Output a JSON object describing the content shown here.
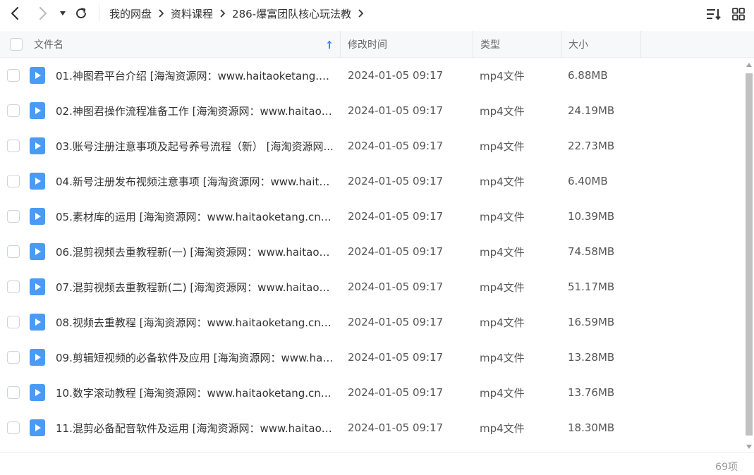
{
  "toolbar": {
    "back_icon": "chevron-left-icon",
    "forward_icon": "chevron-right-icon",
    "history_icon": "caret-down-icon",
    "refresh_icon": "refresh-icon",
    "sort_icon": "sort-icon",
    "view_icon": "grid-view-icon"
  },
  "breadcrumb": [
    "我的网盘",
    "资料课程",
    "286-爆富团队核心玩法教"
  ],
  "table": {
    "columns": {
      "name": "文件名",
      "modified": "修改时间",
      "type": "类型",
      "size": "大小"
    },
    "rows": [
      {
        "name": "01.神图君平台介绍 [海淘资源网：www.haitaoketang.c...",
        "modified": "2024-01-05 09:17",
        "type": "mp4文件",
        "size": "6.88MB"
      },
      {
        "name": "02.神图君操作流程准备工作 [海淘资源网：www.haitaok...",
        "modified": "2024-01-05 09:17",
        "type": "mp4文件",
        "size": "24.19MB"
      },
      {
        "name": "03.账号注册注意事项及起号养号流程（新） [海淘资源网...",
        "modified": "2024-01-05 09:17",
        "type": "mp4文件",
        "size": "22.73MB"
      },
      {
        "name": "04.新号注册发布视频注意事项 [海淘资源网：www.haita...",
        "modified": "2024-01-05 09:17",
        "type": "mp4文件",
        "size": "6.40MB"
      },
      {
        "name": "05.素材库的运用 [海淘资源网：www.haitaoketang.cn]....",
        "modified": "2024-01-05 09:17",
        "type": "mp4文件",
        "size": "10.39MB"
      },
      {
        "name": "06.混剪视频去重教程新(一) [海淘资源网：www.haitaok...",
        "modified": "2024-01-05 09:17",
        "type": "mp4文件",
        "size": "74.58MB"
      },
      {
        "name": "07.混剪视频去重教程新(二) [海淘资源网：www.haitaok...",
        "modified": "2024-01-05 09:17",
        "type": "mp4文件",
        "size": "51.17MB"
      },
      {
        "name": "08.视频去重教程 [海淘资源网：www.haitaoketang.cn]....",
        "modified": "2024-01-05 09:17",
        "type": "mp4文件",
        "size": "16.59MB"
      },
      {
        "name": "09.剪辑短视频的必备软件及应用 [海淘资源网：www.hai...",
        "modified": "2024-01-05 09:17",
        "type": "mp4文件",
        "size": "13.28MB"
      },
      {
        "name": "10.数字滚动教程 [海淘资源网：www.haitaoketang.cn]....",
        "modified": "2024-01-05 09:17",
        "type": "mp4文件",
        "size": "13.76MB"
      },
      {
        "name": "11.混剪必备配音软件及运用 [海淘资源网：www.haitaok...",
        "modified": "2024-01-05 09:17",
        "type": "mp4文件",
        "size": "18.30MB"
      }
    ]
  },
  "footer": {
    "item_count": "69项"
  },
  "colors": {
    "accent": "#3d8af7",
    "file_icon": "#4a9bf5"
  }
}
